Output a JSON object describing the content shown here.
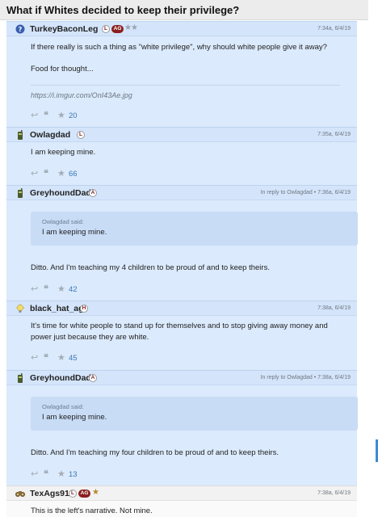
{
  "thread": {
    "title": "What if Whites decided to keep their privilege?"
  },
  "posts": [
    {
      "username": "TurkeyBaconLeg",
      "avatar_icon": "question-icon",
      "badges": [
        "L"
      ],
      "pill_badge": "AG",
      "stars": "★★",
      "meta": "7:34a, 6/4/19",
      "paragraphs": [
        "If there really is such a thing as \"white privilege\", why should white people give it away?",
        "Food for thought..."
      ],
      "link": "https://i.imgur.com/OnI43Ae.jpg",
      "count": "20"
    },
    {
      "username": "Owlagdad",
      "avatar_icon": "walkie-icon",
      "badges": [
        "L"
      ],
      "meta": "7:35a, 6/4/19",
      "paragraphs": [
        "I am keeping mine."
      ],
      "count": "66"
    },
    {
      "username": "GreyhoundDad",
      "avatar_icon": "walkie-icon",
      "badges": [
        "A"
      ],
      "meta": "In reply to Owlagdad • 7:36a, 6/4/19",
      "quote_who": "Owlagdad said:",
      "quote_text": "I am keeping mine.",
      "paragraphs": [
        "Ditto. And I'm teaching my 4 children to be proud of and to keep theirs."
      ],
      "count": "42"
    },
    {
      "username": "black_hat_ag",
      "avatar_icon": "lightbulb-icon",
      "badges": [
        "H"
      ],
      "meta": "7:38a, 6/4/19",
      "paragraphs": [
        "It's time for white people to stand up for themselves and to stop giving away money and power just because they are white."
      ],
      "count": "45"
    },
    {
      "username": "GreyhoundDad",
      "avatar_icon": "walkie-icon",
      "badges": [
        "A"
      ],
      "meta": "In reply to Owlagdad • 7:38a, 6/4/19",
      "quote_who": "Owlagdad said:",
      "quote_text": "I am keeping mine.",
      "paragraphs": [
        "Ditto. And I'm teaching my four children to be proud of and to keep theirs."
      ],
      "count": "13"
    },
    {
      "username": "TexAgs91",
      "avatar_icon": "binoculars-icon",
      "badges": [
        "L"
      ],
      "pill_badge": "AG",
      "stars": "★",
      "meta": "7:38a, 6/4/19",
      "paragraphs": [
        "This is the left's narrative. Not mine."
      ]
    }
  ],
  "colors": {
    "post_bg": "#dbeafc",
    "count_link": "#3c78b8",
    "badge_pill": "#8b1f1f"
  }
}
